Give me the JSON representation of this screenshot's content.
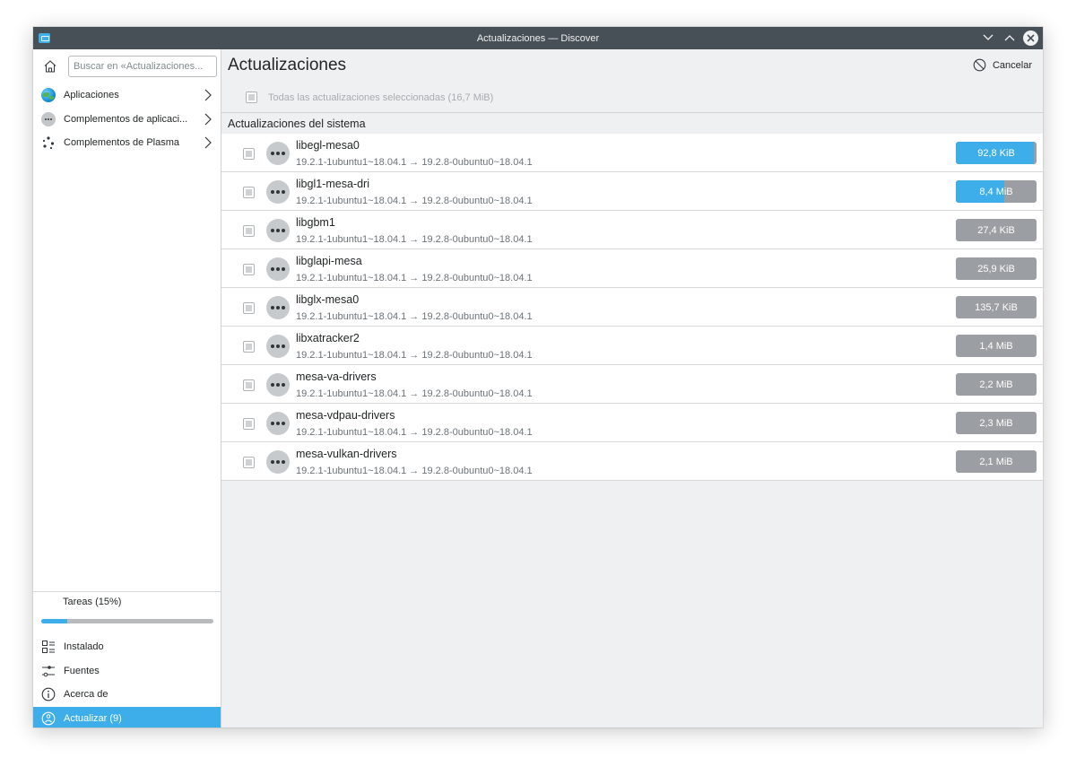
{
  "window": {
    "title": "Actualizaciones — Discover"
  },
  "sidebar": {
    "search_placeholder": "Buscar en «Actualizaciones...",
    "categories": [
      {
        "label": "Aplicaciones",
        "icon": "globe-icon"
      },
      {
        "label": "Complementos de aplicaci...",
        "icon": "dots-icon"
      },
      {
        "label": "Complementos de Plasma",
        "icon": "plasma-icon"
      }
    ],
    "tasks_label": "Tareas (15%)",
    "tasks_progress": 0.15,
    "nav": [
      {
        "label": "Instalado",
        "icon": "installed-icon"
      },
      {
        "label": "Fuentes",
        "icon": "sources-icon"
      },
      {
        "label": "Acerca de",
        "icon": "info-icon"
      },
      {
        "label": "Actualizar (9)",
        "icon": "update-icon"
      }
    ]
  },
  "main": {
    "title": "Actualizaciones",
    "cancel_label": "Cancelar",
    "select_all_label": "Todas las actualizaciones seleccionadas (16,7 MiB)",
    "section_title": "Actualizaciones del sistema",
    "updates": [
      {
        "name": "libegl-mesa0",
        "version": "19.2.1-1ubuntu1~18.04.1 → 19.2.8-0ubuntu0~18.04.1",
        "size": "92,8 KiB",
        "progress": 0.97
      },
      {
        "name": "libgl1-mesa-dri",
        "version": "19.2.1-1ubuntu1~18.04.1 → 19.2.8-0ubuntu0~18.04.1",
        "size": "8,4 MiB",
        "progress": 0.6
      },
      {
        "name": "libgbm1",
        "version": "19.2.1-1ubuntu1~18.04.1 → 19.2.8-0ubuntu0~18.04.1",
        "size": "27,4 KiB",
        "progress": 0
      },
      {
        "name": "libglapi-mesa",
        "version": "19.2.1-1ubuntu1~18.04.1 → 19.2.8-0ubuntu0~18.04.1",
        "size": "25,9 KiB",
        "progress": 0
      },
      {
        "name": "libglx-mesa0",
        "version": "19.2.1-1ubuntu1~18.04.1 → 19.2.8-0ubuntu0~18.04.1",
        "size": "135,7 KiB",
        "progress": 0
      },
      {
        "name": "libxatracker2",
        "version": "19.2.1-1ubuntu1~18.04.1 → 19.2.8-0ubuntu0~18.04.1",
        "size": "1,4 MiB",
        "progress": 0
      },
      {
        "name": "mesa-va-drivers",
        "version": "19.2.1-1ubuntu1~18.04.1 → 19.2.8-0ubuntu0~18.04.1",
        "size": "2,2 MiB",
        "progress": 0
      },
      {
        "name": "mesa-vdpau-drivers",
        "version": "19.2.1-1ubuntu1~18.04.1 → 19.2.8-0ubuntu0~18.04.1",
        "size": "2,3 MiB",
        "progress": 0
      },
      {
        "name": "mesa-vulkan-drivers",
        "version": "19.2.1-1ubuntu1~18.04.1 → 19.2.8-0ubuntu0~18.04.1",
        "size": "2,1 MiB",
        "progress": 0
      }
    ]
  },
  "colors": {
    "accent": "#3daee9",
    "titlebar": "#475057",
    "size_bar_idle": "#9b9ea2"
  }
}
